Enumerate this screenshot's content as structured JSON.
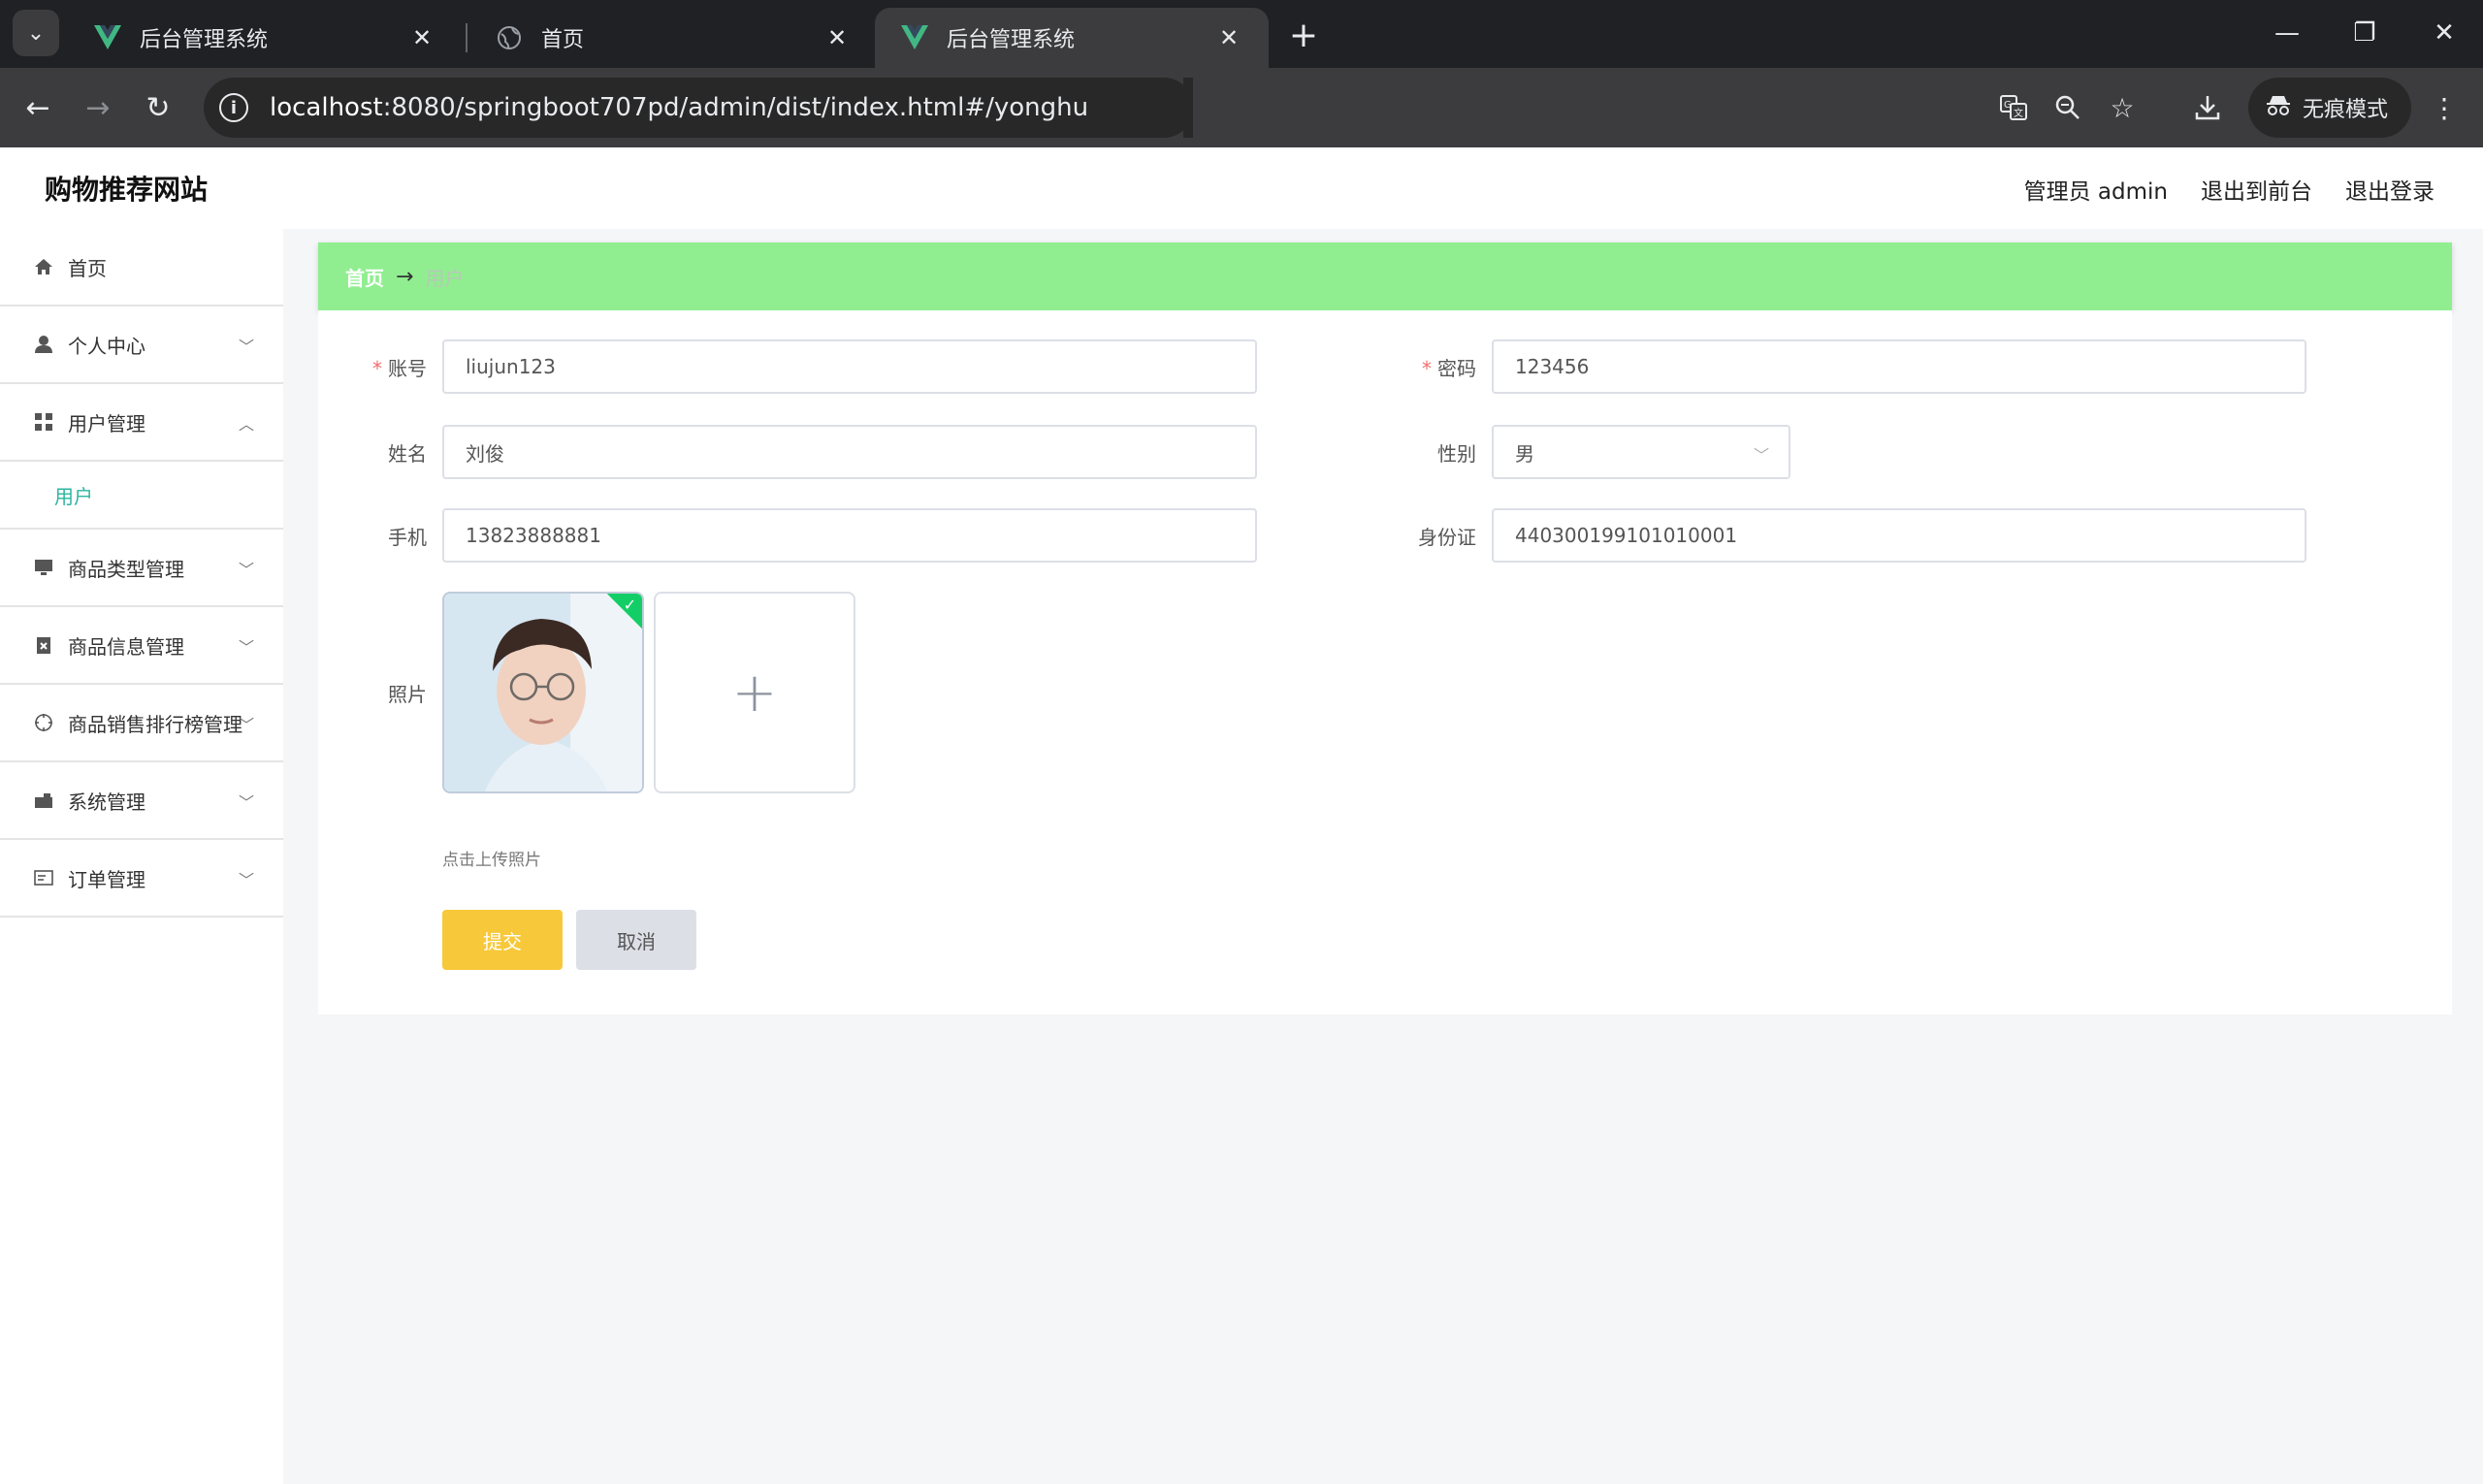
{
  "browser": {
    "tabs": [
      {
        "label": "后台管理系统",
        "active": false,
        "favicon": "vue-logo-icon"
      },
      {
        "label": "首页",
        "active": false,
        "favicon": "globe-icon"
      },
      {
        "label": "后台管理系统",
        "active": true,
        "favicon": "vue-logo-icon"
      }
    ],
    "url_host": "localhost",
    "url_path": ":8080/springboot707pd/admin/dist/index.html#/yonghu",
    "incognito_label": "无痕模式"
  },
  "header": {
    "brand": "购物推荐网站",
    "user": "管理员 admin",
    "to_front": "退出到前台",
    "logout": "退出登录"
  },
  "sidebar": {
    "items": [
      {
        "label": "首页",
        "icon": "home-icon"
      },
      {
        "label": "个人中心",
        "icon": "user-icon"
      },
      {
        "label": "用户管理",
        "icon": "grid-icon"
      },
      {
        "label": "商品类型管理",
        "icon": "monitor-icon"
      },
      {
        "label": "商品信息管理",
        "icon": "clipboard-icon"
      },
      {
        "label": "商品销售排行榜管理",
        "icon": "compass-icon"
      },
      {
        "label": "系统管理",
        "icon": "camera-icon"
      },
      {
        "label": "订单管理",
        "icon": "card-icon"
      }
    ],
    "sub_item": "用户"
  },
  "breadcrumb": {
    "home": "首页",
    "arrow": "→",
    "current": "用户"
  },
  "form": {
    "account_label": "账号",
    "account_value": "liujun123",
    "password_label": "密码",
    "password_value": "123456",
    "name_label": "姓名",
    "name_value": "刘俊",
    "gender_label": "性别",
    "gender_value": "男",
    "phone_label": "手机",
    "phone_value": "13823888881",
    "idcard_label": "身份证",
    "idcard_value": "440300199101010001",
    "photo_label": "照片",
    "upload_tip": "点击上传照片",
    "submit": "提交",
    "cancel": "取消"
  },
  "colors": {
    "breadcrumb_bg": "#90ee90",
    "submit_bg": "#f7c83a",
    "cancel_bg": "#dcdfe6",
    "active_sub": "#2bb5a0",
    "required": "#f56c6c"
  }
}
